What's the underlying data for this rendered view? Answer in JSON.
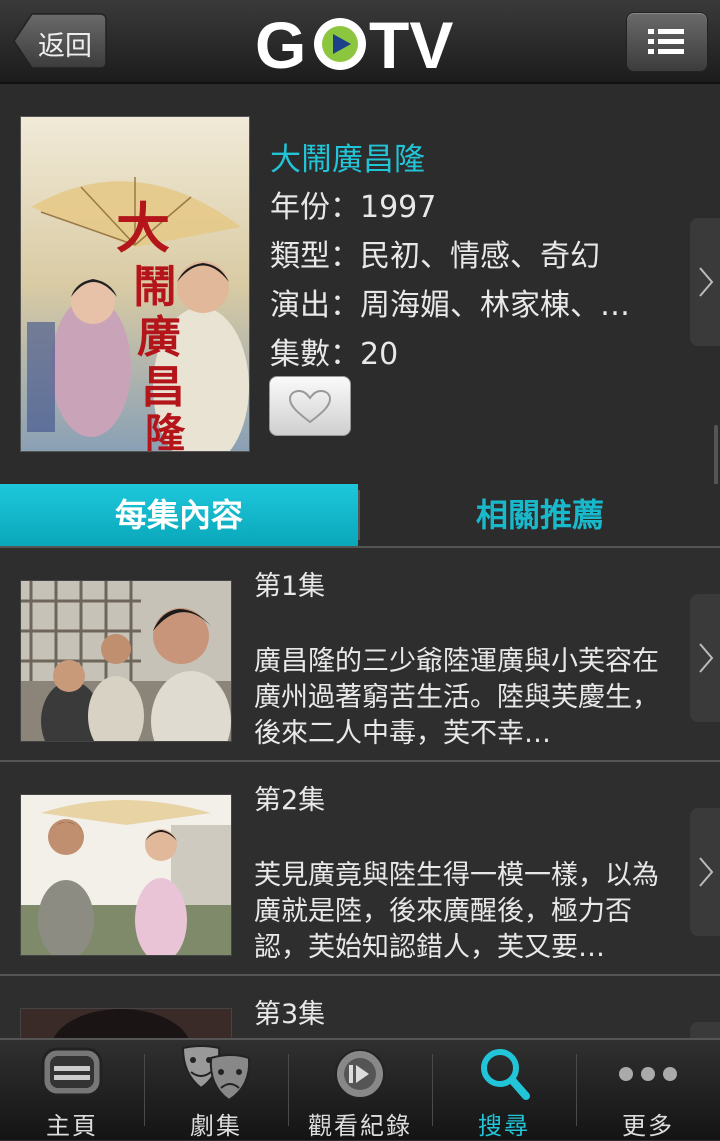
{
  "header": {
    "back_label": "返回",
    "logo_text": "GOTV"
  },
  "show": {
    "title": "大鬧廣昌隆",
    "year": "年份：1997",
    "genre": "類型：民初、情感、奇幻",
    "cast": "演出：周海媚、林家棟、…",
    "episodes": "集數：20"
  },
  "tabs": {
    "episode_content": "每集內容",
    "related": "相關推薦"
  },
  "episode_list": [
    {
      "title": "第1集",
      "desc": "廣昌隆的三少爺陸運廣與小芙容在廣州過著窮苦生活。陸與芙慶生，後來二人中毒，芙不幸…"
    },
    {
      "title": "第2集",
      "desc": "芙見廣竟與陸生得一模一樣，以為廣就是陸，後來廣醒後，極力否認，芙始知認錯人，芙又要…"
    },
    {
      "title": "第3集",
      "desc": ""
    }
  ],
  "nav": {
    "home": "主頁",
    "drama": "劇集",
    "history": "觀看紀錄",
    "search": "搜尋",
    "more": "更多"
  },
  "colors": {
    "accent": "#22c4d8",
    "background": "#2e2e2e"
  }
}
